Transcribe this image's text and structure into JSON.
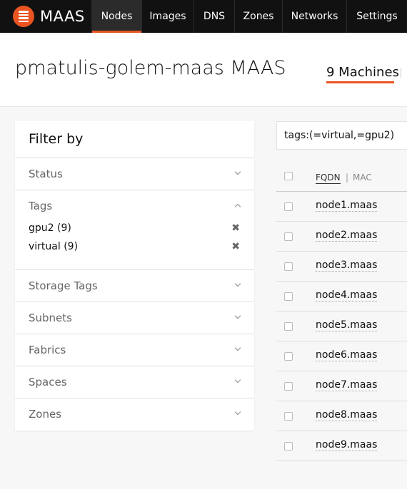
{
  "nav": {
    "brand": "MAAS",
    "items": [
      {
        "label": "Nodes",
        "active": true
      },
      {
        "label": "Images",
        "active": false
      },
      {
        "label": "DNS",
        "active": false
      },
      {
        "label": "Zones",
        "active": false
      },
      {
        "label": "Networks",
        "active": false
      },
      {
        "label": "Settings",
        "active": false
      }
    ]
  },
  "header": {
    "title": "pmatulis-golem-maas MAAS",
    "machines_tab": "9 Machines"
  },
  "filter": {
    "title": "Filter by",
    "sections": {
      "status": "Status",
      "tags": "Tags",
      "storage_tags": "Storage Tags",
      "subnets": "Subnets",
      "fabrics": "Fabrics",
      "spaces": "Spaces",
      "zones": "Zones"
    },
    "selected_tags": [
      "gpu2 (9)",
      "virtual (9)"
    ],
    "remove_glyph": "✖"
  },
  "search": {
    "value": "tags:(=virtual,=gpu2)"
  },
  "table": {
    "columns": {
      "fqdn": "FQDN",
      "separator": "|",
      "mac": "MAC"
    },
    "rows": [
      "node1.maas",
      "node2.maas",
      "node3.maas",
      "node4.maas",
      "node5.maas",
      "node6.maas",
      "node7.maas",
      "node8.maas",
      "node9.maas"
    ]
  },
  "colors": {
    "accent": "#e95420",
    "nav_bg": "#111111"
  }
}
